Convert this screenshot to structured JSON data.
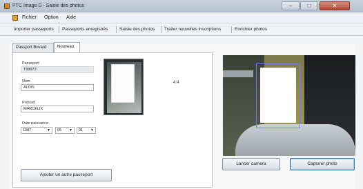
{
  "window": {
    "title": "PTC Image D - Saisie des photos",
    "controls": {
      "minimize": "–",
      "maximize": "□",
      "close": "✕"
    }
  },
  "menubar": {
    "items": [
      "Fichier",
      "Option",
      "Aide"
    ]
  },
  "toolbar": {
    "items": [
      "Importer passeports",
      "Passeports enregistrés",
      "Saisie des photos",
      "Traiter nouvelles inscriptions",
      "Enrichier photos"
    ]
  },
  "tabs": [
    {
      "label": "Passport Buvard",
      "active": false
    },
    {
      "label": "Nouveau",
      "active": true
    }
  ],
  "form": {
    "passport": {
      "label": "Passeport",
      "value": "T98973"
    },
    "nom": {
      "label": "Nom",
      "value": "ALDIS"
    },
    "prenom": {
      "label": "Prénom",
      "value": "MARCELIX"
    },
    "date": {
      "label": "Date naissance",
      "year": "1987",
      "month": "05",
      "day": "01"
    }
  },
  "ratio_text": "4:4",
  "buttons": {
    "add_passport": "Ajouter un autre passeport",
    "launch_camera": "Lancer camera",
    "capture_photo": "Capturer photo"
  },
  "colors": {
    "accent": "#3a78c8",
    "detection_box": "#6a7dff"
  }
}
